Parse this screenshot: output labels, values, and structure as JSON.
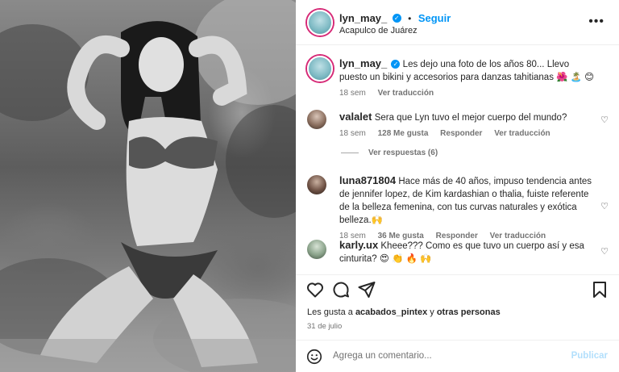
{
  "header": {
    "username": "lyn_may_",
    "follow_label": "Seguir",
    "location": "Acapulco de Juárez",
    "more_icon": "more-horizontal-icon"
  },
  "caption": {
    "username": "lyn_may_",
    "text": "Les dejo una foto de los años 80... Llevo puesto un bikini y accesorios para danzas tahitianas 🌺 🏝️ 😊",
    "time": "18 sem",
    "translate": "Ver traducción"
  },
  "comments": [
    {
      "username": "valalet",
      "text": "Sera que Lyn tuvo el mejor cuerpo del mundo?",
      "time": "18 sem",
      "likes": "128 Me gusta",
      "reply": "Responder",
      "translate": "Ver traducción"
    },
    {
      "username": "luna871804",
      "text": "Hace más de 40 años, impuso tendencia antes de jennifer lopez, de Kim kardashian o thalia, fuiste referente de la belleza femenina, con tus curvas naturales y exótica belleza.🙌",
      "time": "18 sem",
      "likes": "36 Me gusta",
      "reply": "Responder",
      "translate": "Ver traducción"
    },
    {
      "username": "karly.ux",
      "text": "Kheee??? Como es que tuvo un cuerpo así y esa cinturita? 😍 👏 🔥 🙌"
    }
  ],
  "view_replies": "Ver respuestas (6)",
  "actions": {
    "likes_prefix": "Les gusta a ",
    "likes_user": "acabados_pintex",
    "likes_suffix": " y ",
    "likes_others": "otras personas",
    "date": "31 de julio"
  },
  "add_comment": {
    "placeholder": "Agrega un comentario...",
    "publish": "Publicar"
  },
  "colors": {
    "link_blue": "#0095f6",
    "muted": "#737373",
    "publish_disabled": "#b2dffc"
  }
}
